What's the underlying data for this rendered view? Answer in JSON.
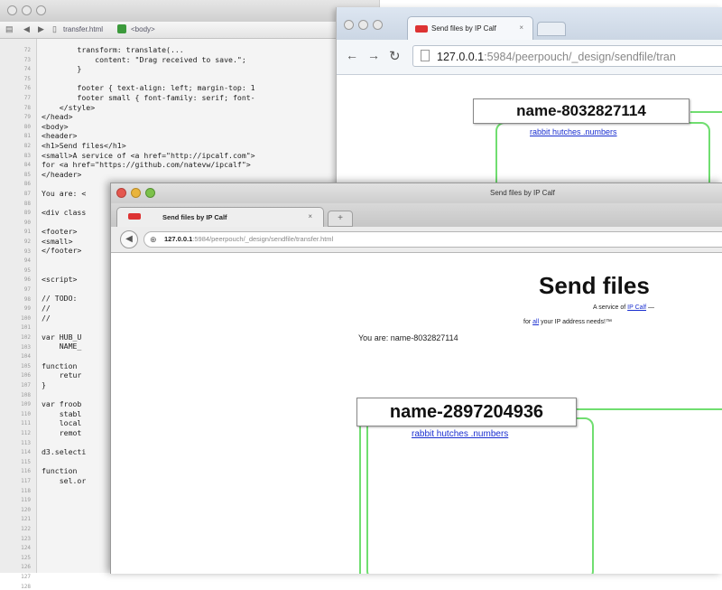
{
  "editor": {
    "toolbar": {
      "path": "transfer.html",
      "element": "<body>"
    },
    "line_numbers": [
      "72",
      "73",
      "74",
      "75",
      "76",
      "77",
      "78",
      "79",
      "80",
      "81",
      "82",
      "83",
      "84",
      "85",
      "86",
      "87",
      "88",
      "89",
      "90",
      "91",
      "92",
      "93",
      "94",
      "95",
      "96",
      "97",
      "98",
      "99",
      "100",
      "101",
      "102",
      "103",
      "104",
      "105",
      "106",
      "107",
      "108",
      "109",
      "110",
      "111",
      "112",
      "113",
      "114",
      "115",
      "116",
      "117",
      "118",
      "119",
      "120",
      "121",
      "122",
      "123",
      "124",
      "125",
      "126",
      "127",
      "128"
    ],
    "code_lines": [
      "        transform: translate(...",
      "            content: \"Drag received to save.\";",
      "        }",
      "",
      "        footer { text-align: left; margin-top: 1",
      "        footer small { font-family: serif; font-",
      "    </style>",
      "</head>",
      "<body>",
      "<header>",
      "<h1>Send files</h1>",
      "<small>A service of <a href=\"http://ipcalf.com\">",
      "for <a href=\"https://github.com/natevw/ipcalf\">",
      "</header>",
      "",
      "You are: <",
      "",
      "<div class",
      "",
      "<footer>",
      "<small> ",
      "</footer>",
      "",
      "",
      "<script>",
      "",
      "// TODO: ",
      "//",
      "//",
      "",
      "var HUB_U",
      "    NAME_",
      "",
      "function ",
      "    retur",
      "}",
      "",
      "var froob",
      "    stabl",
      "    local",
      "    remot",
      "",
      "d3.selecti",
      "",
      "function ",
      "    sel.or",
      "",
      "",
      ""
    ]
  },
  "browser1": {
    "tab_title": "Send files by IP Calf",
    "tab_close": "×",
    "url_host": "127.0.0.1",
    "url_rest": ":5984/peerpouch/_design/sendfile/tran",
    "peer_name": "name-8032827114",
    "peer_link": "rabbit hutches .numbers"
  },
  "browser2": {
    "window_title": "Send files by IP Calf",
    "tab_title": "Send files by IP Calf",
    "tab_close": "×",
    "newtab": "+",
    "url_host": "127.0.0.1",
    "url_rest": ":5984/peerpouch/_design/sendfile/transfer.html",
    "heading": "Send files",
    "service_prefix": "A service of ",
    "service_link": "IP Calf",
    "service_suffix": " —",
    "for_prefix": "for ",
    "for_link": "all",
    "for_suffix": " your IP address needs!™",
    "you_are": "You are: name-8032827114",
    "peer_name": "name-2897204936",
    "peer_link": "rabbit hutches .numbers"
  }
}
